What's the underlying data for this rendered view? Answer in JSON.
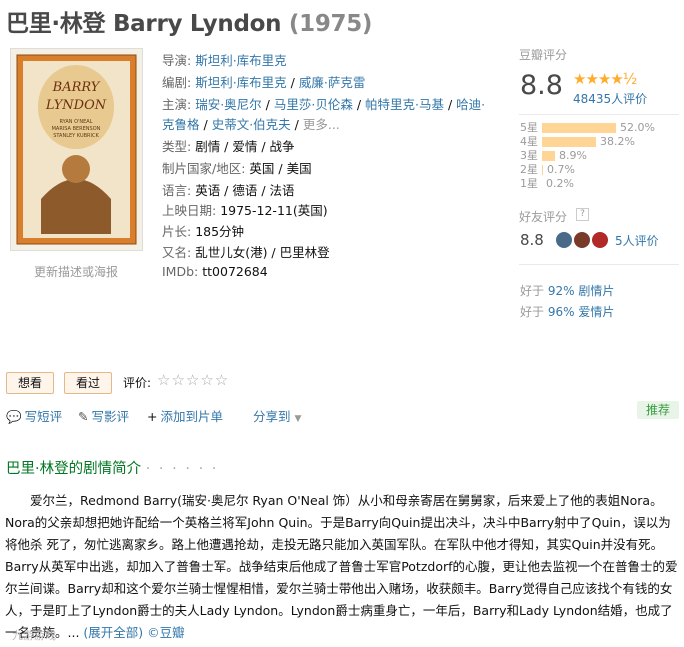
{
  "title": {
    "main": "巴里·林登 Barry Lyndon",
    "year": "(1975)"
  },
  "poster": {
    "line1": "BARRY",
    "line2": "LYNDON",
    "credits1": "RYAN O'NEAL",
    "credits2": "MARISA BERENSON",
    "credits3": "STANLEY KUBRICK"
  },
  "update_link": "更新描述或海报",
  "info": {
    "director_k": "导演:",
    "director_v": "斯坦利·库布里克",
    "writer_k": "编剧:",
    "writer_v1": "斯坦利·库布里克",
    "writer_sep": " / ",
    "writer_v2": "威廉·萨克雷",
    "cast_k": "主演:",
    "cast_1": "瑞安·奥尼尔",
    "cast_2": "马里莎·贝伦森",
    "cast_3": "帕特里克·马基",
    "cast_4": "哈迪·",
    "cast_5": "克鲁格",
    "cast_6": "史蒂文·伯克夫",
    "cast_more": "更多...",
    "genre_k": "类型:",
    "genre_v": "剧情 / 爱情 / 战争",
    "country_k": "制片国家/地区:",
    "country_v": "英国 / 美国",
    "lang_k": "语言:",
    "lang_v": "英语 / 德语 / 法语",
    "date_k": "上映日期:",
    "date_v": "1975-12-11(英国)",
    "runtime_k": "片长:",
    "runtime_v": "185分钟",
    "aka_k": "又名:",
    "aka_v": "乱世儿女(港) / 巴里林登",
    "imdb_k": "IMDb:",
    "imdb_v": "tt0072684"
  },
  "rating": {
    "label": "豆瓣评分",
    "score": "8.8",
    "stars": "★★★★½",
    "count": "48435人评价",
    "bars": [
      {
        "label": "5星",
        "pct": "52.0%",
        "value": 52.0
      },
      {
        "label": "4星",
        "pct": "38.2%",
        "value": 38.2
      },
      {
        "label": "3星",
        "pct": "8.9%",
        "value": 8.9
      },
      {
        "label": "2星",
        "pct": "0.7%",
        "value": 0.7
      },
      {
        "label": "1星",
        "pct": "0.2%",
        "value": 0.2
      }
    ],
    "bar_color": "#ffd596"
  },
  "friends": {
    "label": "好友评分",
    "q": "?",
    "score": "8.8",
    "count": "5人评价"
  },
  "better": [
    {
      "prefix": "好于 ",
      "pct": "92%",
      "genre": "剧情片"
    },
    {
      "prefix": "好于 ",
      "pct": "96%",
      "genre": "爱情片"
    }
  ],
  "actions": {
    "want": "想看",
    "seen": "看过",
    "rate_label": "评价:",
    "rate_stars": "☆☆☆☆☆",
    "short_review": "写短评",
    "review": "写影评",
    "add_list": "添加到片单",
    "share": "分享到",
    "recommend": "推荐"
  },
  "summary": {
    "title": "巴里·林登的剧情简介",
    "dots": "· · · · · ·",
    "text": "爱尔兰，Redmond Barry(瑞安·奥尼尔 Ryan O'Neal 饰）从小和母亲寄居在舅舅家，后来爱上了他的表姐Nora。Nora的父亲却想把她许配给一个英格兰将军John Quin。于是Barry向Quin提出决斗，决斗中Barry射中了Quin，误以为将他杀 死了，匆忙逃离家乡。路上他遭遇抢劫，走投无路只能加入英国军队。在军队中他才得知，其实Quin并没有死。Barry从英军中出逃，却加入了普鲁士军。战争结束后他成了普鲁士军官Potzdorf的心腹，更让他去监视一个在普鲁士的爱尔兰间谍。Barry却和这个爱尔兰骑士惺惺相惜，爱尔兰骑士带他出入赌场，收获颇丰。Barry觉得自己应该找个有钱的女人，于是盯上了Lyndon爵士的夫人Lady Lyndon。Lyndon爵士病重身亡，一年后，Barry和Lady Lyndon结婚，也成了一名贵族。",
    "ellipsis": "... ",
    "more": "(展开全部)",
    "copyright": " ©豆瓣"
  },
  "watermark": "九游游戏"
}
